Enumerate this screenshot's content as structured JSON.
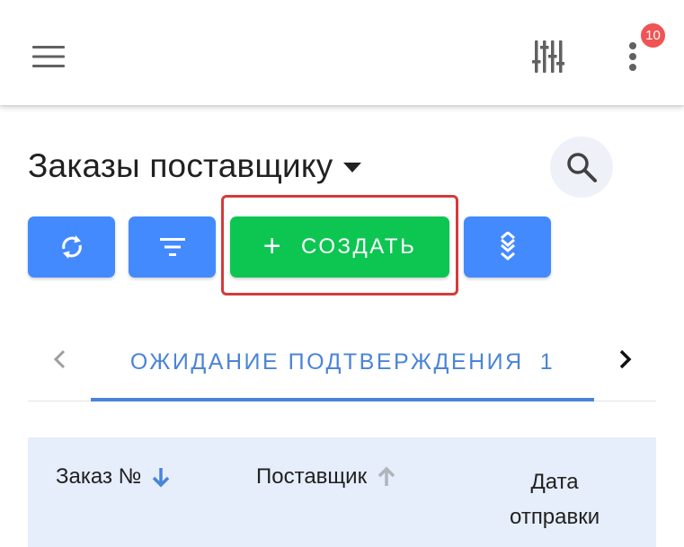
{
  "appbar": {
    "menu_icon": "menu-icon",
    "tune_icon": "tune-icon",
    "more_icon": "more-vert-icon",
    "notification_count": "10"
  },
  "page": {
    "title": "Заказы поставщику",
    "title_caret_icon": "arrow-drop-down-icon",
    "search_icon": "search-icon"
  },
  "toolbar": {
    "refresh_icon": "sync-icon",
    "filter_icon": "filter-list-icon",
    "create_label": "СОЗДАТЬ",
    "create_icon": "+",
    "expand_icon": "expand-all-icon",
    "accent_blue": "#448aff",
    "create_green": "#0dc651",
    "highlight_red": "#d63a3a"
  },
  "tabs": {
    "prev_icon": "chevron-left-icon",
    "next_icon": "chevron-right-icon",
    "active": {
      "label": "ОЖИДАНИЕ ПОДТВЕРЖДЕНИЯ",
      "count": "1"
    },
    "accent": "#4a84d8"
  },
  "table": {
    "columns": [
      {
        "label": "Заказ №",
        "sort": "desc",
        "active": true
      },
      {
        "label": "Поставщик",
        "sort": "asc",
        "active": false
      },
      {
        "label_line1": "Дата",
        "label_line2": "отправки"
      }
    ]
  }
}
